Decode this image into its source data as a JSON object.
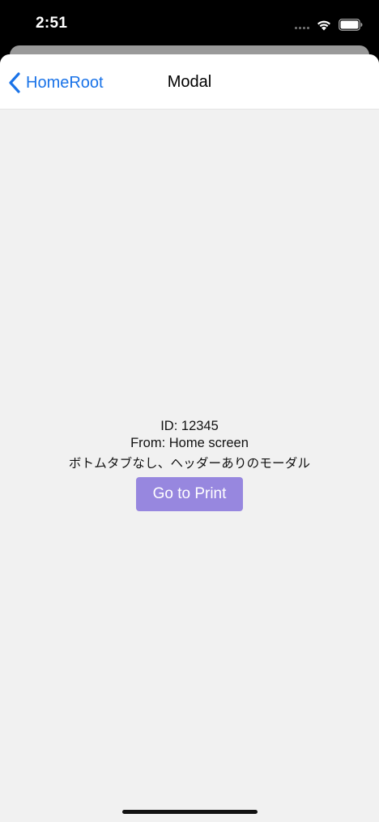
{
  "status_bar": {
    "time": "2:51",
    "icons": [
      "cellular-signal-icon",
      "wifi-icon",
      "battery-icon"
    ]
  },
  "nav": {
    "back_label": "HomeRoot",
    "back_icon": "chevron-left-icon",
    "title": "Modal"
  },
  "content": {
    "id_line": "ID: 12345",
    "from_line": "From: Home screen",
    "description": "ボトムタブなし、ヘッダーありのモーダル",
    "button_label": "Go to Print"
  },
  "colors": {
    "accent": "#1a73e8",
    "button": "#9787df",
    "background": "#f1f1f1",
    "header": "#ffffff"
  }
}
